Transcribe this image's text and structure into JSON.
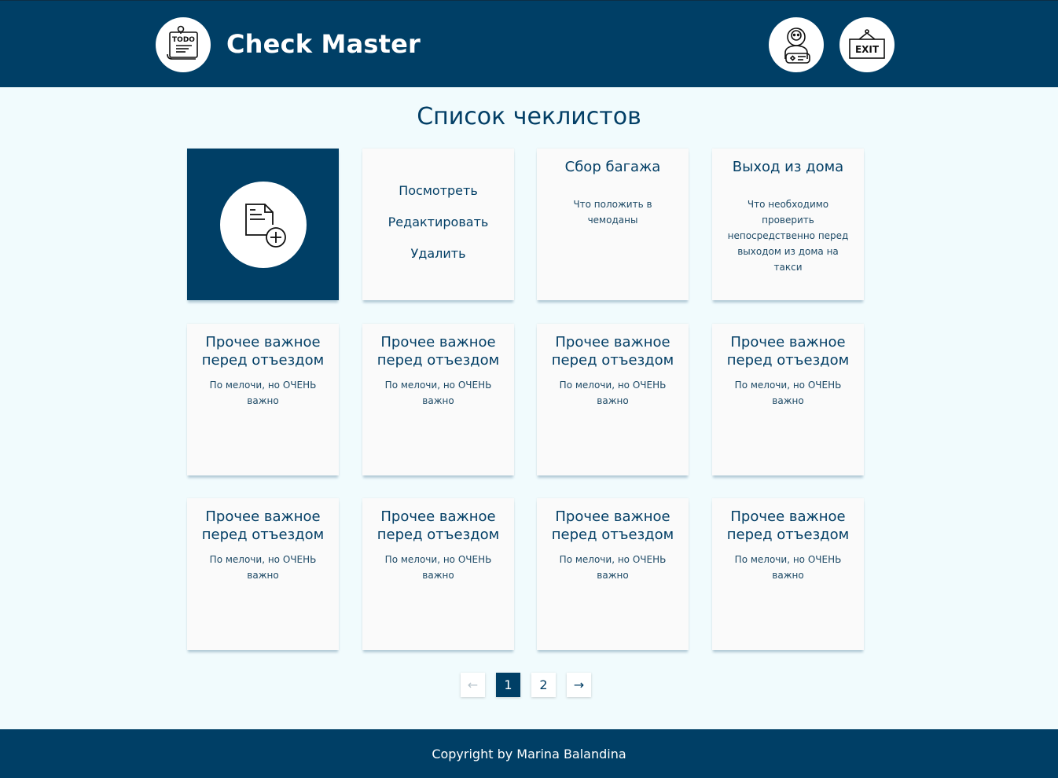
{
  "header": {
    "brand": "Check Master",
    "logo_icon": "todo-list-icon",
    "logo_text": "TODO",
    "profile_icon": "user-profile-icon",
    "exit_icon": "exit-sign-icon",
    "exit_text": "EXIT"
  },
  "page": {
    "title": "Список чеклистов"
  },
  "cards": {
    "add_icon": "add-document-icon",
    "menu": {
      "view": "Посмотреть",
      "edit": "Редактировать",
      "delete": "Удалить"
    },
    "items": [
      {
        "title": "Сбор багажа",
        "description": "Что положить в чемоданы"
      },
      {
        "title": "Выход из дома",
        "description": "Что необходимо проверить непосредственно перед выходом из дома на такси"
      },
      {
        "title": "Прочее важное перед отъездом",
        "description": "По мелочи, но ОЧЕНЬ важно"
      },
      {
        "title": "Прочее важное перед отъездом",
        "description": "По мелочи, но ОЧЕНЬ важно"
      },
      {
        "title": "Прочее важное перед отъездом",
        "description": "По мелочи, но ОЧЕНЬ важно"
      },
      {
        "title": "Прочее важное перед отъездом",
        "description": "По мелочи, но ОЧЕНЬ важно"
      },
      {
        "title": "Прочее важное перед отъездом",
        "description": "По мелочи, но ОЧЕНЬ важно"
      },
      {
        "title": "Прочее важное перед отъездом",
        "description": "По мелочи, но ОЧЕНЬ важно"
      },
      {
        "title": "Прочее важное перед отъездом",
        "description": "По мелочи, но ОЧЕНЬ важно"
      },
      {
        "title": "Прочее важное перед отъездом",
        "description": "По мелочи, но ОЧЕНЬ важно"
      }
    ]
  },
  "pagination": {
    "prev": "←",
    "pages": [
      "1",
      "2"
    ],
    "current": "1",
    "next": "→"
  },
  "footer": {
    "copyright": "Copyright by Marina Balandina"
  },
  "colors": {
    "primary": "#003f66",
    "background": "#f1fbfd",
    "card": "#fafafa",
    "shadow": "#b3cad6"
  }
}
